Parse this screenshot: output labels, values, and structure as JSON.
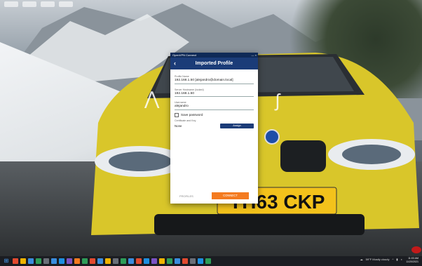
{
  "window": {
    "app_title": "OpenVPN Connect",
    "controls": "— ×",
    "header_title": "Imported Profile",
    "back_icon": "chevron-left-icon"
  },
  "form": {
    "profile_name_label": "Profile Name",
    "profile_name_value": "192.168.1.50 [alejandro@domain.local]",
    "server_hostname_label": "Server Hostname (locked)",
    "server_hostname_value": "192.168.1.50",
    "username_label": "Username",
    "username_value": "alejandro",
    "save_password_label": "Save password",
    "save_password_checked": false,
    "cert_key_label": "Certificate and Key",
    "cert_key_value": "None",
    "assign_button": "Assign"
  },
  "footer": {
    "profiles_button": "PROFILES",
    "connect_button": "CONNECT"
  },
  "car": {
    "plate": "YH63 CKP"
  },
  "taskbar": {
    "weather": "59°F  Mostly cloudy",
    "time": "11:03 AM",
    "date": "11/20/2021"
  },
  "colors": {
    "vpn_header": "#1b3c78",
    "vpn_titlebar": "#0f2a57",
    "connect_orange": "#f47b20",
    "taskbar": "#1b1d22",
    "car_yellow": "#d9c62a"
  }
}
